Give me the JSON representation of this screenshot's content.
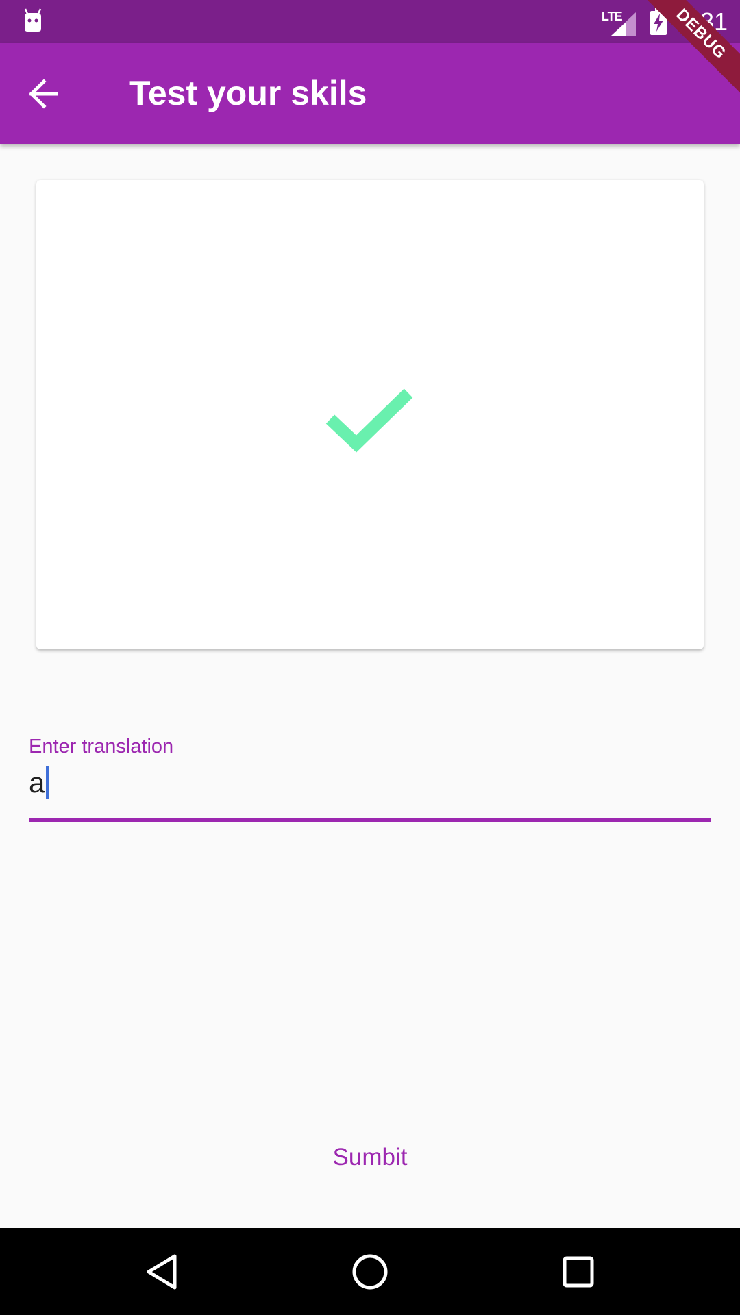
{
  "status_bar": {
    "time": "4:31",
    "network": "LTE",
    "left_icon": "android-icon"
  },
  "debug_banner": {
    "label": "DEBUG"
  },
  "app_bar": {
    "back_icon": "back-arrow-icon",
    "title": "Test your skils"
  },
  "card": {
    "icon": "check-icon",
    "icon_color": "#69f0ae"
  },
  "translation_field": {
    "label": "Enter translation",
    "value": "a"
  },
  "submit": {
    "label": "Sumbit"
  },
  "nav_bar": {
    "back": "nav-back-icon",
    "home": "nav-home-icon",
    "recents": "nav-recents-icon"
  },
  "colors": {
    "primary": "#9c27b0",
    "status_bar": "#7b1f8a",
    "accent_check": "#69f0ae",
    "cursor": "#3f6fd8",
    "ribbon": "#8e1b3c"
  }
}
